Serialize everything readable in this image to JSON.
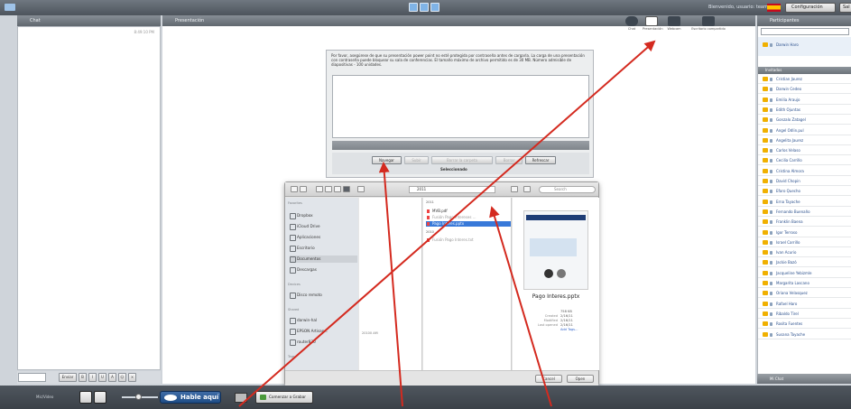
{
  "topbar": {
    "user_label": "Bienvenido, usuario: team",
    "config_label": "Configuración",
    "more_label": "Sal"
  },
  "chat": {
    "title": "Chat",
    "timestamp": "8:49:10 PM",
    "send_label": "Enviar"
  },
  "presentation": {
    "title": "Presentación",
    "toolbar": [
      {
        "label": "Chat"
      },
      {
        "label": "Presentación"
      },
      {
        "label": "Webcam"
      },
      {
        "label": "Escritorio compartido"
      }
    ],
    "upload": {
      "message": "Por favor, asegúrese de que su presentación power point no esté protegida por contraseña antes de cargarla. La carga de una presentación con contraseña puede bloquear su sala de conferencias. El tamaño máximo de archivo permitido es de 30 MB. Número admisible de diapositivas - 100 unidades.",
      "buttons": [
        "Navegar",
        "Subir",
        "Borrar la carpeta",
        "Borrar",
        "Refrescar"
      ],
      "status": "Seleccionado"
    }
  },
  "file_dialog": {
    "folder": "2011",
    "search_placeholder": "Search",
    "sidebar": {
      "favorites_title": "Favorites",
      "favorites": [
        "Dropbox",
        "iCloud Drive",
        "Aplicaciones",
        "Escritorio",
        "Documentos",
        "Descargas"
      ],
      "devices_title": "Devices",
      "devices": [
        "Disco remoto"
      ],
      "shared_title": "Shared",
      "shared": [
        "darwin-hal",
        "EPSON Artisan...",
        "router830"
      ],
      "tags_title": "Tags"
    },
    "col1_note": "20100 AM",
    "files_group1": "2011",
    "files": [
      {
        "name": "MVB.pdf",
        "state": "normal"
      },
      {
        "name": "Fusión Pago Intereses ...",
        "state": "dim"
      },
      {
        "name": "Pago Interes.pptx",
        "state": "sel"
      }
    ],
    "files_group2": "2010",
    "files2": [
      {
        "name": "Fusión Pago Interes.txt",
        "state": "dim"
      }
    ],
    "preview": {
      "filename": "Pago Interes.pptx",
      "meta": [
        {
          "k": "",
          "v": "758 KB"
        },
        {
          "k": "Created",
          "v": "2/16/11"
        },
        {
          "k": "Modified",
          "v": "2/16/11"
        },
        {
          "k": "Last opened",
          "v": "2/16/11"
        },
        {
          "k": "",
          "v": "Add Tags..."
        }
      ]
    },
    "cancel_label": "Cancel",
    "open_label": "Open"
  },
  "participants": {
    "title": "Participantes",
    "me": "Darwin Haro",
    "group": "Invitados",
    "list": [
      "Cristian Jaurez",
      "Darwin Cedeo",
      "Emilia Araujo",
      "Edith Ojuntas",
      "Gonzalo Zatagel",
      "Angel Odlin.pul",
      "Angelita Jaurez",
      "Carlos Velaso",
      "Cecilia Carrillo",
      "Cristina Almora",
      "David Chopin",
      "Efaro Quecho",
      "Erna Tayache",
      "Fernando Buenaño",
      "Franklin Baena",
      "Igor Terroso",
      "Israel Carrillo",
      "Ivan Acurio",
      "Jackie Bazó",
      "Jacqueline Yebizmle",
      "Margarita Lascano",
      "Oriana Velasquez",
      "Rafael Haro",
      "Ribaldo Tirel",
      "Rosita Fuentes",
      "Susana Tayache"
    ],
    "footer": "Mi Chat"
  },
  "bottombar": {
    "mic_label": "Mic/Video",
    "talk_label": "Hable aquí",
    "grab_label": "Comenzar a Grabar"
  }
}
